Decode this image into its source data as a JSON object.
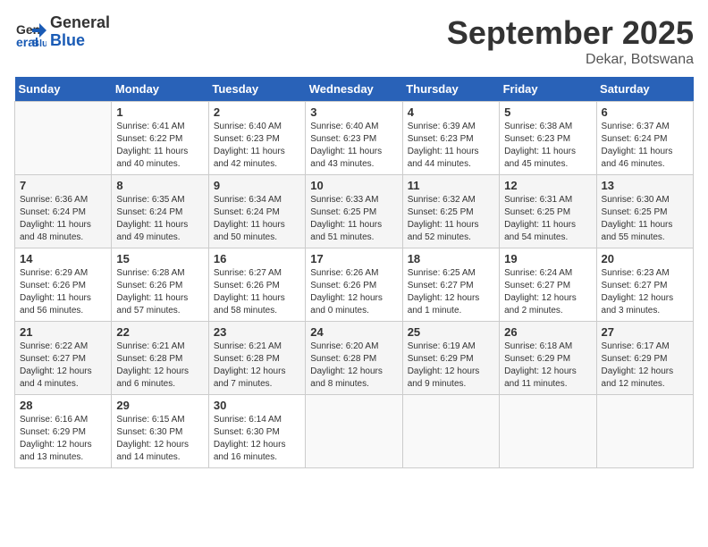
{
  "header": {
    "logo_line1": "General",
    "logo_line2": "Blue",
    "month": "September 2025",
    "location": "Dekar, Botswana"
  },
  "weekdays": [
    "Sunday",
    "Monday",
    "Tuesday",
    "Wednesday",
    "Thursday",
    "Friday",
    "Saturday"
  ],
  "weeks": [
    [
      {
        "day": "",
        "sunrise": "",
        "sunset": "",
        "daylight": ""
      },
      {
        "day": "1",
        "sunrise": "Sunrise: 6:41 AM",
        "sunset": "Sunset: 6:22 PM",
        "daylight": "Daylight: 11 hours and 40 minutes."
      },
      {
        "day": "2",
        "sunrise": "Sunrise: 6:40 AM",
        "sunset": "Sunset: 6:23 PM",
        "daylight": "Daylight: 11 hours and 42 minutes."
      },
      {
        "day": "3",
        "sunrise": "Sunrise: 6:40 AM",
        "sunset": "Sunset: 6:23 PM",
        "daylight": "Daylight: 11 hours and 43 minutes."
      },
      {
        "day": "4",
        "sunrise": "Sunrise: 6:39 AM",
        "sunset": "Sunset: 6:23 PM",
        "daylight": "Daylight: 11 hours and 44 minutes."
      },
      {
        "day": "5",
        "sunrise": "Sunrise: 6:38 AM",
        "sunset": "Sunset: 6:23 PM",
        "daylight": "Daylight: 11 hours and 45 minutes."
      },
      {
        "day": "6",
        "sunrise": "Sunrise: 6:37 AM",
        "sunset": "Sunset: 6:24 PM",
        "daylight": "Daylight: 11 hours and 46 minutes."
      }
    ],
    [
      {
        "day": "7",
        "sunrise": "Sunrise: 6:36 AM",
        "sunset": "Sunset: 6:24 PM",
        "daylight": "Daylight: 11 hours and 48 minutes."
      },
      {
        "day": "8",
        "sunrise": "Sunrise: 6:35 AM",
        "sunset": "Sunset: 6:24 PM",
        "daylight": "Daylight: 11 hours and 49 minutes."
      },
      {
        "day": "9",
        "sunrise": "Sunrise: 6:34 AM",
        "sunset": "Sunset: 6:24 PM",
        "daylight": "Daylight: 11 hours and 50 minutes."
      },
      {
        "day": "10",
        "sunrise": "Sunrise: 6:33 AM",
        "sunset": "Sunset: 6:25 PM",
        "daylight": "Daylight: 11 hours and 51 minutes."
      },
      {
        "day": "11",
        "sunrise": "Sunrise: 6:32 AM",
        "sunset": "Sunset: 6:25 PM",
        "daylight": "Daylight: 11 hours and 52 minutes."
      },
      {
        "day": "12",
        "sunrise": "Sunrise: 6:31 AM",
        "sunset": "Sunset: 6:25 PM",
        "daylight": "Daylight: 11 hours and 54 minutes."
      },
      {
        "day": "13",
        "sunrise": "Sunrise: 6:30 AM",
        "sunset": "Sunset: 6:25 PM",
        "daylight": "Daylight: 11 hours and 55 minutes."
      }
    ],
    [
      {
        "day": "14",
        "sunrise": "Sunrise: 6:29 AM",
        "sunset": "Sunset: 6:26 PM",
        "daylight": "Daylight: 11 hours and 56 minutes."
      },
      {
        "day": "15",
        "sunrise": "Sunrise: 6:28 AM",
        "sunset": "Sunset: 6:26 PM",
        "daylight": "Daylight: 11 hours and 57 minutes."
      },
      {
        "day": "16",
        "sunrise": "Sunrise: 6:27 AM",
        "sunset": "Sunset: 6:26 PM",
        "daylight": "Daylight: 11 hours and 58 minutes."
      },
      {
        "day": "17",
        "sunrise": "Sunrise: 6:26 AM",
        "sunset": "Sunset: 6:26 PM",
        "daylight": "Daylight: 12 hours and 0 minutes."
      },
      {
        "day": "18",
        "sunrise": "Sunrise: 6:25 AM",
        "sunset": "Sunset: 6:27 PM",
        "daylight": "Daylight: 12 hours and 1 minute."
      },
      {
        "day": "19",
        "sunrise": "Sunrise: 6:24 AM",
        "sunset": "Sunset: 6:27 PM",
        "daylight": "Daylight: 12 hours and 2 minutes."
      },
      {
        "day": "20",
        "sunrise": "Sunrise: 6:23 AM",
        "sunset": "Sunset: 6:27 PM",
        "daylight": "Daylight: 12 hours and 3 minutes."
      }
    ],
    [
      {
        "day": "21",
        "sunrise": "Sunrise: 6:22 AM",
        "sunset": "Sunset: 6:27 PM",
        "daylight": "Daylight: 12 hours and 4 minutes."
      },
      {
        "day": "22",
        "sunrise": "Sunrise: 6:21 AM",
        "sunset": "Sunset: 6:28 PM",
        "daylight": "Daylight: 12 hours and 6 minutes."
      },
      {
        "day": "23",
        "sunrise": "Sunrise: 6:21 AM",
        "sunset": "Sunset: 6:28 PM",
        "daylight": "Daylight: 12 hours and 7 minutes."
      },
      {
        "day": "24",
        "sunrise": "Sunrise: 6:20 AM",
        "sunset": "Sunset: 6:28 PM",
        "daylight": "Daylight: 12 hours and 8 minutes."
      },
      {
        "day": "25",
        "sunrise": "Sunrise: 6:19 AM",
        "sunset": "Sunset: 6:29 PM",
        "daylight": "Daylight: 12 hours and 9 minutes."
      },
      {
        "day": "26",
        "sunrise": "Sunrise: 6:18 AM",
        "sunset": "Sunset: 6:29 PM",
        "daylight": "Daylight: 12 hours and 11 minutes."
      },
      {
        "day": "27",
        "sunrise": "Sunrise: 6:17 AM",
        "sunset": "Sunset: 6:29 PM",
        "daylight": "Daylight: 12 hours and 12 minutes."
      }
    ],
    [
      {
        "day": "28",
        "sunrise": "Sunrise: 6:16 AM",
        "sunset": "Sunset: 6:29 PM",
        "daylight": "Daylight: 12 hours and 13 minutes."
      },
      {
        "day": "29",
        "sunrise": "Sunrise: 6:15 AM",
        "sunset": "Sunset: 6:30 PM",
        "daylight": "Daylight: 12 hours and 14 minutes."
      },
      {
        "day": "30",
        "sunrise": "Sunrise: 6:14 AM",
        "sunset": "Sunset: 6:30 PM",
        "daylight": "Daylight: 12 hours and 16 minutes."
      },
      {
        "day": "",
        "sunrise": "",
        "sunset": "",
        "daylight": ""
      },
      {
        "day": "",
        "sunrise": "",
        "sunset": "",
        "daylight": ""
      },
      {
        "day": "",
        "sunrise": "",
        "sunset": "",
        "daylight": ""
      },
      {
        "day": "",
        "sunrise": "",
        "sunset": "",
        "daylight": ""
      }
    ]
  ]
}
